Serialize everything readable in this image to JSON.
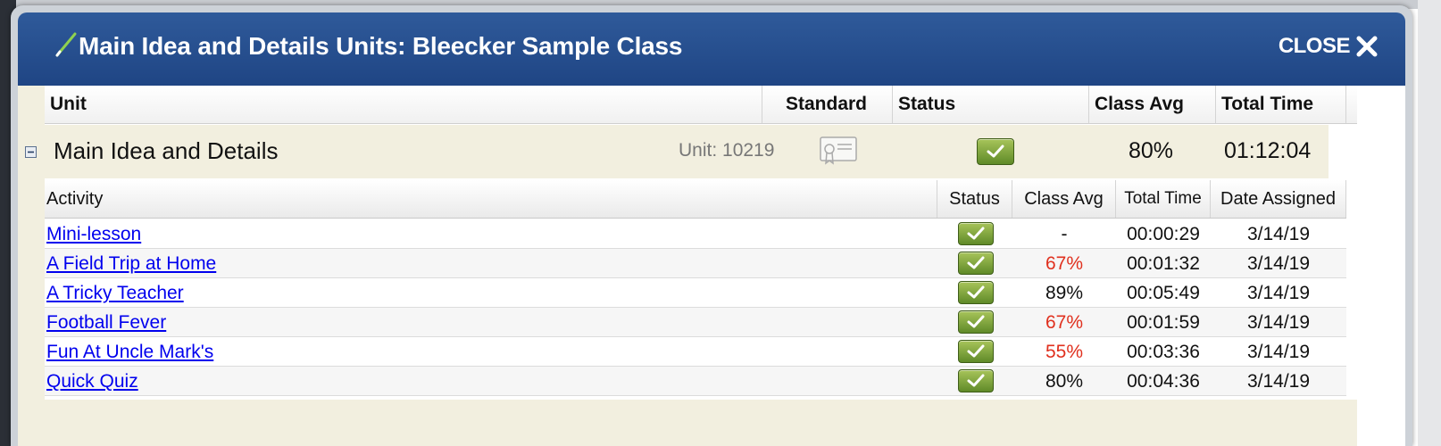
{
  "dialog": {
    "title": "Main Idea and Details Units: Bleecker Sample Class",
    "close_label": "CLOSE",
    "icons": {
      "title": "pencil-icon",
      "close": "close-icon"
    }
  },
  "unit_table": {
    "headers": {
      "unit": "Unit",
      "standard": "Standard",
      "status": "Status",
      "class_avg": "Class Avg",
      "total_time": "Total Time"
    },
    "unit": {
      "name": "Main Idea and Details",
      "unit_id": "Unit: 10219",
      "standard_icon": "certificate-icon",
      "status": "complete",
      "class_avg": "80%",
      "total_time": "01:12:04"
    }
  },
  "activity_table": {
    "headers": {
      "activity": "Activity",
      "status": "Status",
      "class_avg": "Class Avg",
      "total_time": "Total Time",
      "date_assigned": "Date Assigned"
    },
    "rows": [
      {
        "name": "Mini-lesson",
        "status": "complete",
        "class_avg": "-",
        "total_time": "00:00:29",
        "date_assigned": "3/14/19"
      },
      {
        "name": "A Field Trip at Home",
        "status": "complete",
        "class_avg": "67%",
        "total_time": "00:01:32",
        "date_assigned": "3/14/19"
      },
      {
        "name": "A Tricky Teacher",
        "status": "complete",
        "class_avg": "89%",
        "total_time": "00:05:49",
        "date_assigned": "3/14/19"
      },
      {
        "name": "Football Fever",
        "status": "complete",
        "class_avg": "67%",
        "total_time": "00:01:59",
        "date_assigned": "3/14/19"
      },
      {
        "name": "Fun At Uncle Mark's",
        "status": "complete",
        "class_avg": "55%",
        "total_time": "00:03:36",
        "date_assigned": "3/14/19"
      },
      {
        "name": "Quick Quiz",
        "status": "complete",
        "class_avg": "80%",
        "total_time": "00:04:36",
        "date_assigned": "3/14/19"
      }
    ]
  },
  "colors": {
    "title_bar": "#2a5393",
    "unit_row_bg": "#f2efdf",
    "link": "#0000ee",
    "low_score": "#e0301e",
    "check_green": "#7ea43a"
  }
}
